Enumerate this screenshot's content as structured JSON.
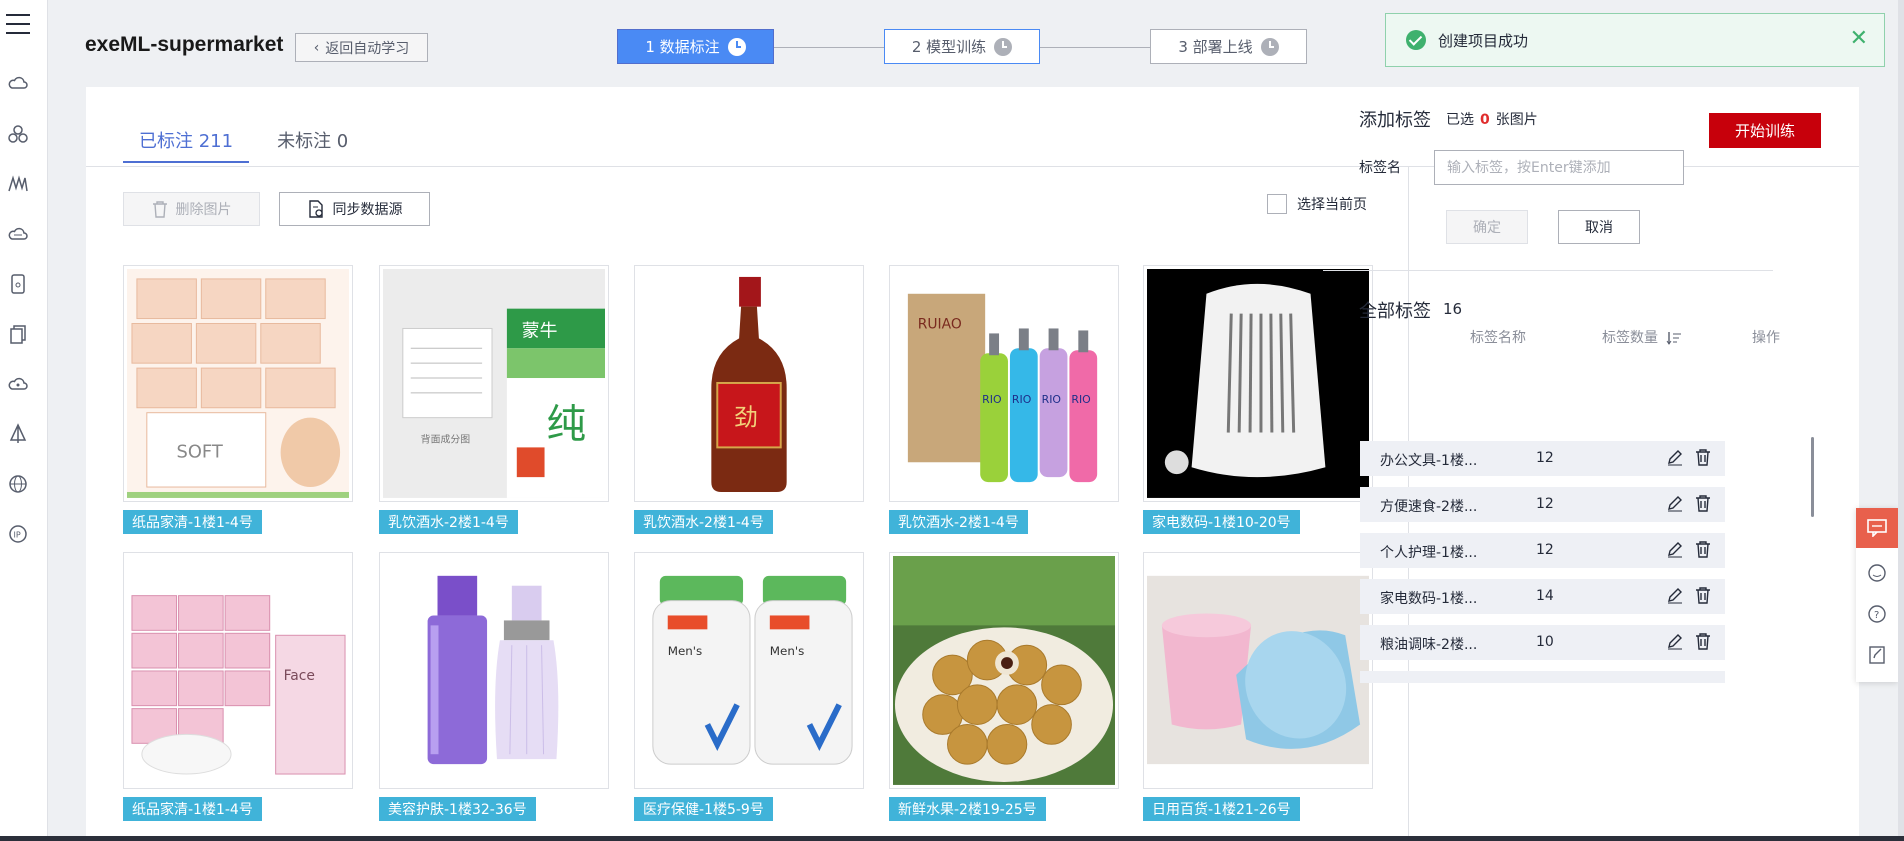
{
  "header": {
    "project_title": "exeML-supermarket",
    "back_label": "返回自动学习",
    "steps": [
      {
        "label": "1 数据标注",
        "state": "active"
      },
      {
        "label": "2 模型训练",
        "state": "pending"
      },
      {
        "label": "3 部署上线",
        "state": "pending"
      }
    ]
  },
  "toast": {
    "message": "创建项目成功",
    "close_icon": "close-icon"
  },
  "tabs": [
    {
      "label": "已标注 211",
      "active": true
    },
    {
      "label": "未标注 0",
      "active": false
    }
  ],
  "toolbar": {
    "start_training": "开始训练",
    "delete_images": "删除图片",
    "sync_source": "同步数据源",
    "select_page": "选择当前页"
  },
  "images": [
    {
      "tag": "纸品家清-1楼1-4号",
      "subject": "tissue-packs"
    },
    {
      "tag": "乳饮酒水-2楼1-4号",
      "subject": "milk-carton"
    },
    {
      "tag": "乳饮酒水-2楼1-4号",
      "subject": "liquor-bottle"
    },
    {
      "tag": "乳饮酒水-2楼1-4号",
      "subject": "rio-cocktails"
    },
    {
      "tag": "家电数码-1楼10-20号",
      "subject": "heater"
    },
    {
      "tag": "纸品家清-1楼1-4号",
      "subject": "face-tissues"
    },
    {
      "tag": "美容护肤-1楼32-36号",
      "subject": "skincare-bottles"
    },
    {
      "tag": "医疗保健-1楼5-9号",
      "subject": "vitamin-bottles"
    },
    {
      "tag": "新鲜水果-2楼19-25号",
      "subject": "longan-fruit"
    },
    {
      "tag": "日用百货-1楼21-26号",
      "subject": "plastic-buckets"
    }
  ],
  "add_label": {
    "title": "添加标签",
    "selected_prefix": "已选",
    "selected_count": "0",
    "selected_suffix": "张图片",
    "name_label": "标签名",
    "input_placeholder": "输入标签，按Enter键添加",
    "confirm": "确定",
    "cancel": "取消"
  },
  "all_labels": {
    "title": "全部标签",
    "count": "16",
    "columns": [
      "标签名称",
      "标签数量",
      "操作"
    ],
    "rows": [
      {
        "name": "办公文具-1楼...",
        "count": "12"
      },
      {
        "name": "方便速食-2楼...",
        "count": "12"
      },
      {
        "name": "个人护理-1楼...",
        "count": "12"
      },
      {
        "name": "家电数码-1楼...",
        "count": "14"
      },
      {
        "name": "粮油调味-2楼...",
        "count": "10"
      }
    ]
  },
  "colors": {
    "accent": "#4a8af4",
    "primary_red": "#c7000b",
    "tag_bg": "#40b3d9",
    "success": "#3fb16e"
  }
}
